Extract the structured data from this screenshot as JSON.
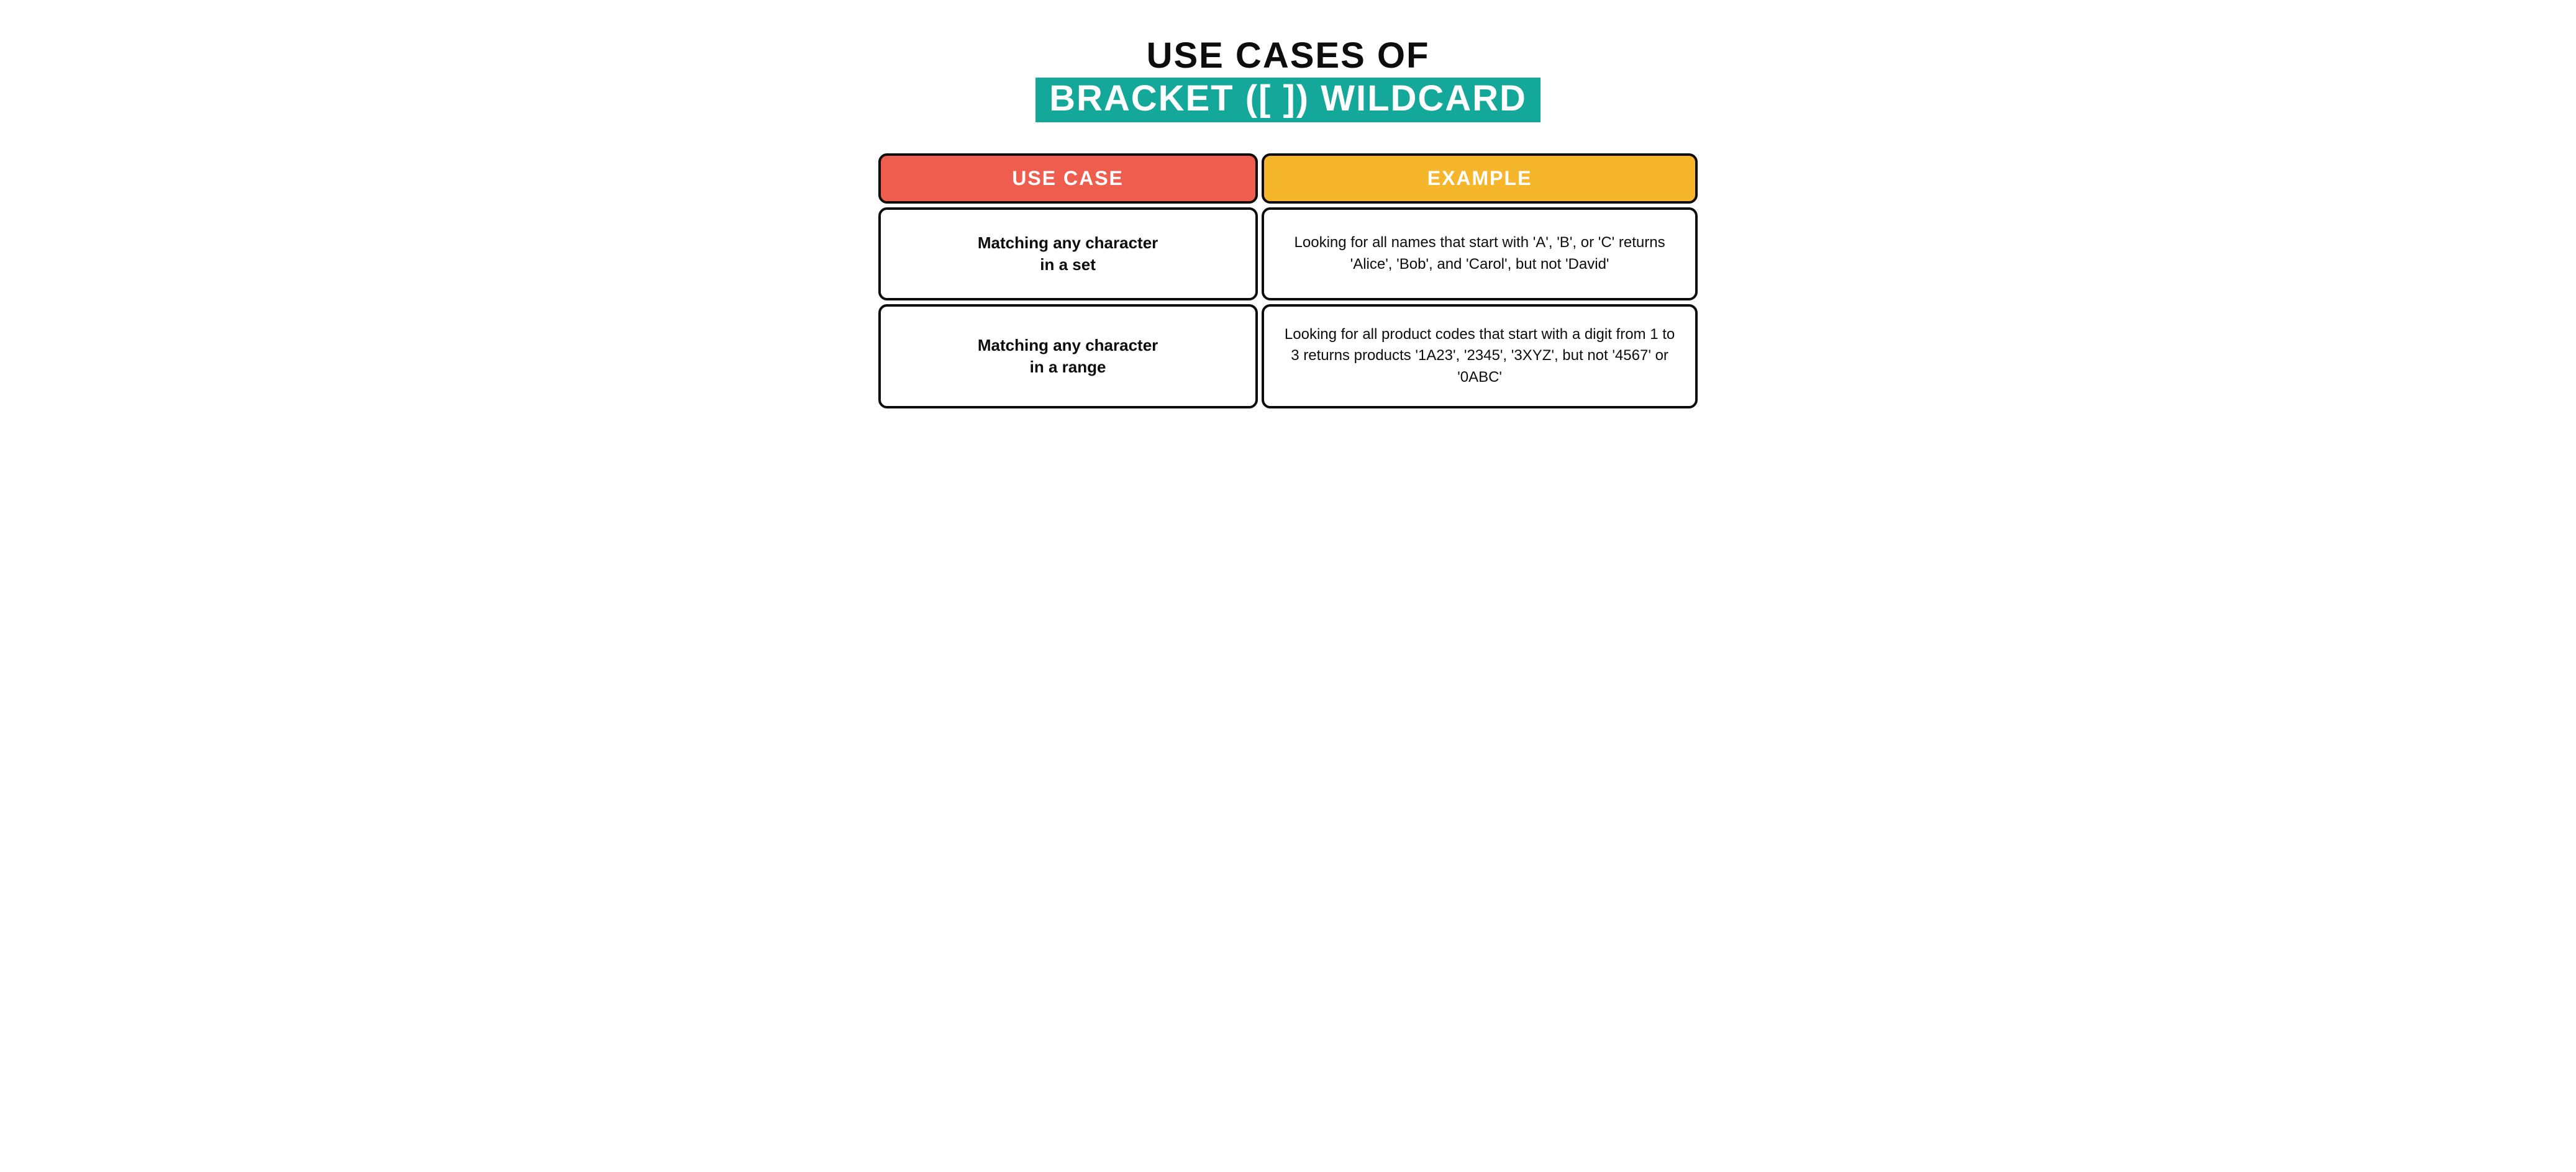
{
  "title": {
    "line1": "USE CASES OF",
    "line2": "BRACKET ([ ]) WILDCARD"
  },
  "headers": {
    "usecase": "USE CASE",
    "example": "EXAMPLE"
  },
  "rows": [
    {
      "usecase": "Matching any character\nin a set",
      "example": "Looking for all names that start with 'A', 'B', or 'C' returns 'Alice', 'Bob', and 'Carol', but not 'David'"
    },
    {
      "usecase": "Matching any character\nin a range",
      "example": "Looking for all product codes that start with a digit from 1 to 3 returns products '1A23', '2345', '3XYZ', but not '4567' or '0ABC'"
    }
  ]
}
